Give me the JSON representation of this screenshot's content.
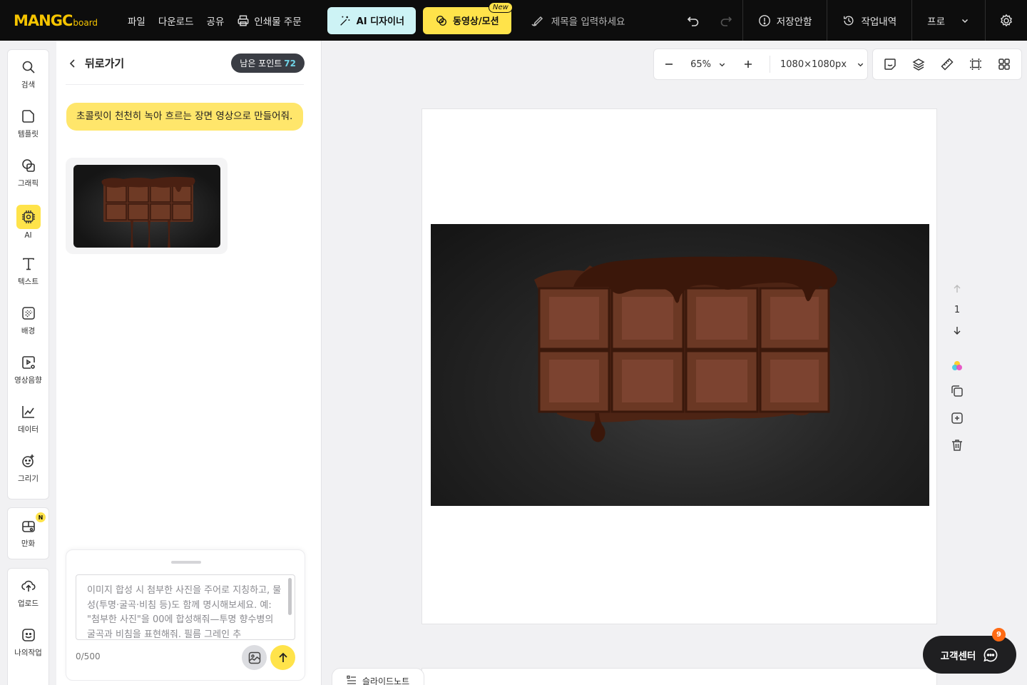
{
  "app": {
    "logo_main": "MANGC",
    "logo_sub": "board"
  },
  "topbar": {
    "menu": [
      "파일",
      "다운로드",
      "공유"
    ],
    "print_order": "인쇄물 주문",
    "ai_designer": "AI 디자이너",
    "video_motion": "동영상/모션",
    "new_badge": "New",
    "title_placeholder": "제목을 입력하세요",
    "unsaved": "저장안함",
    "history": "작업내역",
    "plan": "프로"
  },
  "rail": {
    "items": [
      {
        "label": "검색",
        "icon": "search-icon"
      },
      {
        "label": "템플릿",
        "icon": "template-icon"
      },
      {
        "label": "그래픽",
        "icon": "graphic-icon"
      },
      {
        "label": "AI",
        "icon": "ai-chip-icon"
      },
      {
        "label": "텍스트",
        "icon": "text-icon"
      },
      {
        "label": "배경",
        "icon": "background-icon"
      },
      {
        "label": "영상음향",
        "icon": "video-audio-icon"
      },
      {
        "label": "데이터",
        "icon": "chart-icon"
      },
      {
        "label": "그리기",
        "icon": "draw-icon"
      }
    ],
    "comic": {
      "label": "만화",
      "badge": "N"
    },
    "upload": {
      "label": "업로드"
    },
    "mywork": {
      "label": "나의작업"
    }
  },
  "panel": {
    "back": "뒤로가기",
    "points_label": "남은 포인트",
    "points_value": "72",
    "prompt": "초콜릿이 천천히 녹아 흐르는 장면 영상으로 만들어줘.",
    "composer_placeholder": "이미지 합성 시 첨부한 사진을 주어로 지칭하고, 물성(투명·굴곡·비침 등)도 함께 명시해보세요. 예: \"첨부한 사진\"을 00에 합성해줘—투명 향수병의 굴곡과 비침을 표현해줘. 필름 그레인 추",
    "counter": "0/500"
  },
  "canvas": {
    "zoom": "65%",
    "size": "1080×1080px",
    "page_number": "1"
  },
  "bottom": {
    "slide_note": "슬라이드노트"
  },
  "help": {
    "label": "고객센터",
    "badge": "9"
  },
  "colors": {
    "accent_yellow": "#ffe34a",
    "ai_cyan": "#cdf3f5",
    "topbar_bg": "#0d0d0d",
    "help_badge": "#ff6a13"
  }
}
